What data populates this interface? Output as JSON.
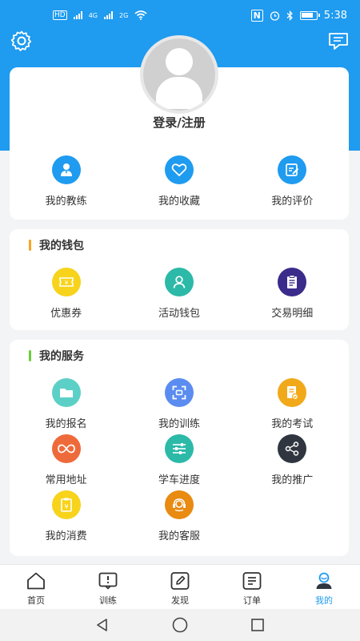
{
  "status_bar": {
    "left_badges": [
      "HD",
      "4G",
      "2G"
    ],
    "time": "5:38"
  },
  "header": {
    "settings_icon": "gear-icon",
    "message_icon": "message-icon"
  },
  "profile": {
    "login_label": "登录/注册",
    "quick_links": [
      {
        "label": "我的教练",
        "icon": "coach-icon",
        "color": "#1f9bf0"
      },
      {
        "label": "我的收藏",
        "icon": "heart-icon",
        "color": "#1f9bf0"
      },
      {
        "label": "我的评价",
        "icon": "edit-icon",
        "color": "#1f9bf0"
      }
    ]
  },
  "wallet": {
    "title": "我的钱包",
    "accent": "#f5a623",
    "items": [
      {
        "label": "优惠券",
        "icon": "coupon-icon",
        "color": "#f7d31c"
      },
      {
        "label": "活动钱包",
        "icon": "user-icon",
        "color": "#2cb9a8"
      },
      {
        "label": "交易明细",
        "icon": "clipboard-icon",
        "color": "#3b2b8a"
      }
    ]
  },
  "services": {
    "title": "我的服务",
    "accent": "#6acc3a",
    "items": [
      {
        "label": "我的报名",
        "icon": "folder-icon",
        "color": "#5cd0c6"
      },
      {
        "label": "我的训练",
        "icon": "scan-icon",
        "color": "#5b8cf0"
      },
      {
        "label": "我的考试",
        "icon": "document-icon",
        "color": "#f1a91a"
      },
      {
        "label": "常用地址",
        "icon": "infinity-icon",
        "color": "#ef6a3b"
      },
      {
        "label": "学车进度",
        "icon": "sliders-icon",
        "color": "#2cb9a8"
      },
      {
        "label": "我的推广",
        "icon": "share-icon",
        "color": "#2f3640"
      },
      {
        "label": "我的消费",
        "icon": "receipt-icon",
        "color": "#f7d31c"
      },
      {
        "label": "我的客服",
        "icon": "headset-icon",
        "color": "#e98a11"
      }
    ]
  },
  "bottom_nav": {
    "items": [
      {
        "label": "首页",
        "icon": "home-icon"
      },
      {
        "label": "训练",
        "icon": "book-icon"
      },
      {
        "label": "发现",
        "icon": "pencil-icon"
      },
      {
        "label": "订单",
        "icon": "order-icon"
      },
      {
        "label": "我的",
        "icon": "profile-icon",
        "active": true
      }
    ],
    "active_color": "#1f9bf0"
  }
}
